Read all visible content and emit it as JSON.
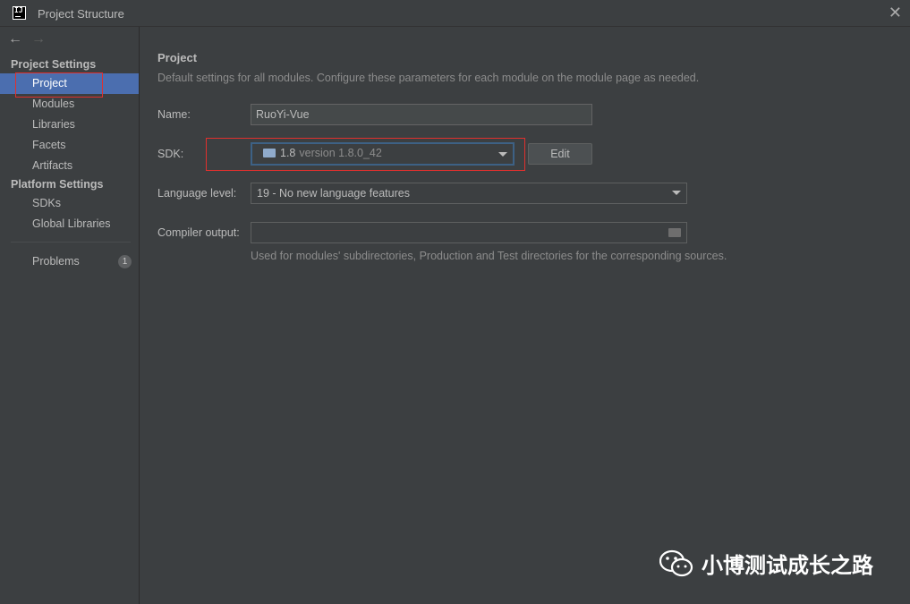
{
  "window": {
    "app_icon_label": "IJ",
    "title": "Project Structure",
    "close_symbol": "✕"
  },
  "nav": {
    "back": "←",
    "forward": "→"
  },
  "sidebar": {
    "project_settings_header": "Project Settings",
    "project_settings_items": [
      {
        "label": "Project",
        "selected": true
      },
      {
        "label": "Modules"
      },
      {
        "label": "Libraries"
      },
      {
        "label": "Facets"
      },
      {
        "label": "Artifacts"
      }
    ],
    "platform_settings_header": "Platform Settings",
    "platform_settings_items": [
      {
        "label": "SDKs"
      },
      {
        "label": "Global Libraries"
      }
    ],
    "problems": {
      "label": "Problems",
      "count": "1"
    }
  },
  "main": {
    "title": "Project",
    "description": "Default settings for all modules. Configure these parameters for each module on the module page as needed.",
    "name_label": "Name:",
    "name_value": "RuoYi-Vue",
    "sdk_label": "SDK:",
    "sdk_value": "1.8",
    "sdk_version": "version 1.8.0_42",
    "edit_label": "Edit",
    "language_level_label": "Language level:",
    "language_level_value": "19 - No new language features",
    "compiler_output_label": "Compiler output:",
    "compiler_output_value": "",
    "compiler_output_hint": "Used for modules' subdirectories, Production and Test directories for the corresponding sources."
  },
  "watermark": {
    "text": "小博测试成长之路"
  },
  "colors": {
    "background": "#3c3f41",
    "selection": "#4b6eaf",
    "highlight_box": "#e0302e",
    "focus_border": "#3d6185"
  }
}
